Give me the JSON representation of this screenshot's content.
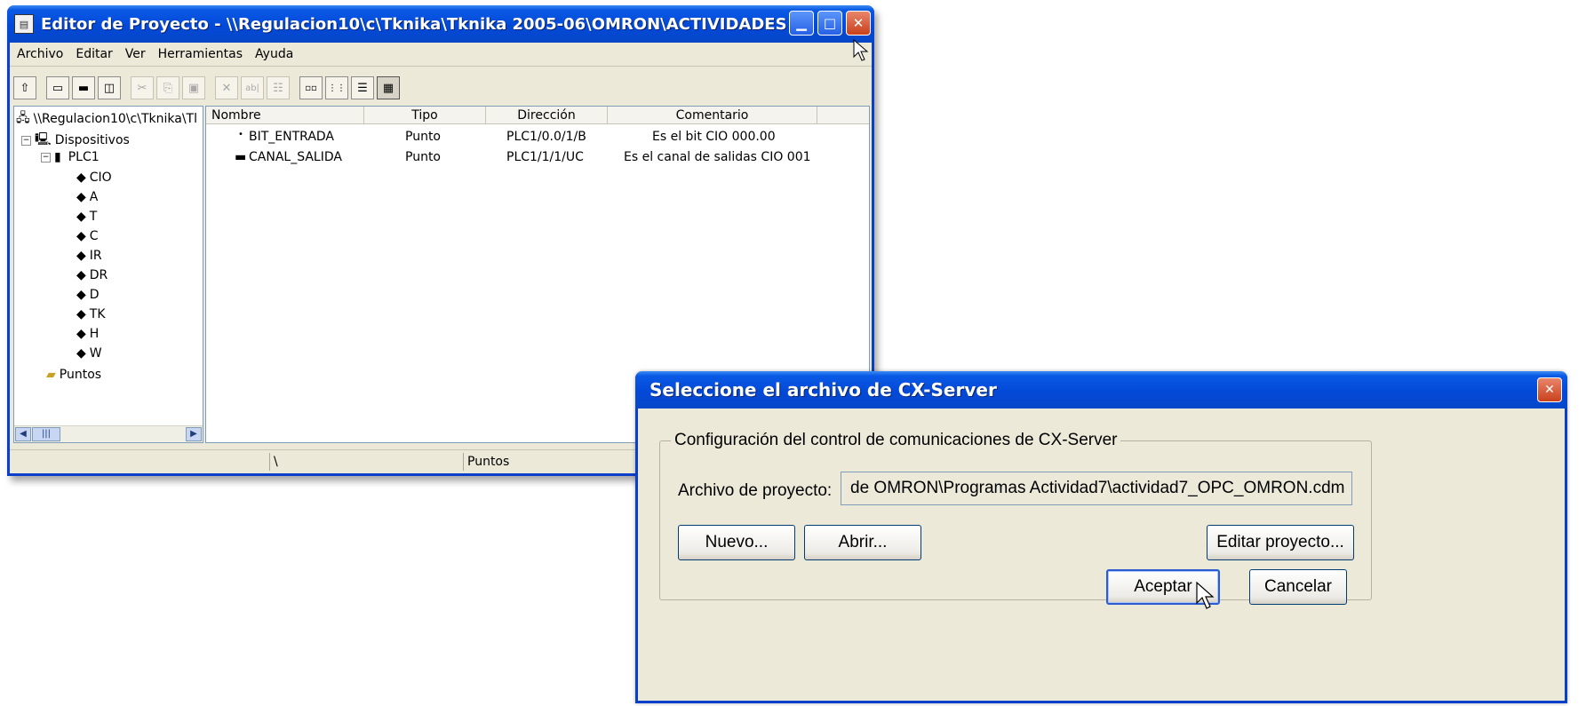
{
  "main_window": {
    "title": "Editor de Proyecto - \\\\Regulacion10\\c\\Tknika\\Tknika 2005-06\\OMRON\\ACTIVIDADES OMRON\\Acti...",
    "menu": [
      "Archivo",
      "Editar",
      "Ver",
      "Herramientas",
      "Ayuda"
    ],
    "tree": {
      "root": "\\\\Regulacion10\\c\\Tknika\\Tl",
      "devices": "Dispositivos",
      "plc": "PLC1",
      "areas": [
        "CIO",
        "A",
        "T",
        "C",
        "IR",
        "DR",
        "D",
        "TK",
        "H",
        "W"
      ],
      "points": "Puntos"
    },
    "list": {
      "columns": [
        "Nombre",
        "Tipo",
        "Dirección",
        "Comentario"
      ],
      "rows": [
        {
          "nombre": "BIT_ENTRADA",
          "tipo": "Punto",
          "direccion": "PLC1/0.0/1/B",
          "comentario": "Es el bit CIO 000.00"
        },
        {
          "nombre": "CANAL_SALIDA",
          "tipo": "Punto",
          "direccion": "PLC1/1/1/UC",
          "comentario": "Es el canal de salidas CIO 001"
        }
      ]
    },
    "status": {
      "path": "\\",
      "section": "Puntos"
    }
  },
  "dialog": {
    "title": "Seleccione el archivo de CX-Server",
    "group_label": "Configuración del control de comunicaciones de CX-Server",
    "field_label": "Archivo de proyecto:",
    "field_value": "de OMRON\\Programas Actividad7\\actividad7_OPC_OMRON.cdm",
    "buttons": {
      "new": "Nuevo...",
      "open": "Abrir...",
      "edit": "Editar proyecto...",
      "ok": "Aceptar",
      "cancel": "Cancelar"
    }
  }
}
